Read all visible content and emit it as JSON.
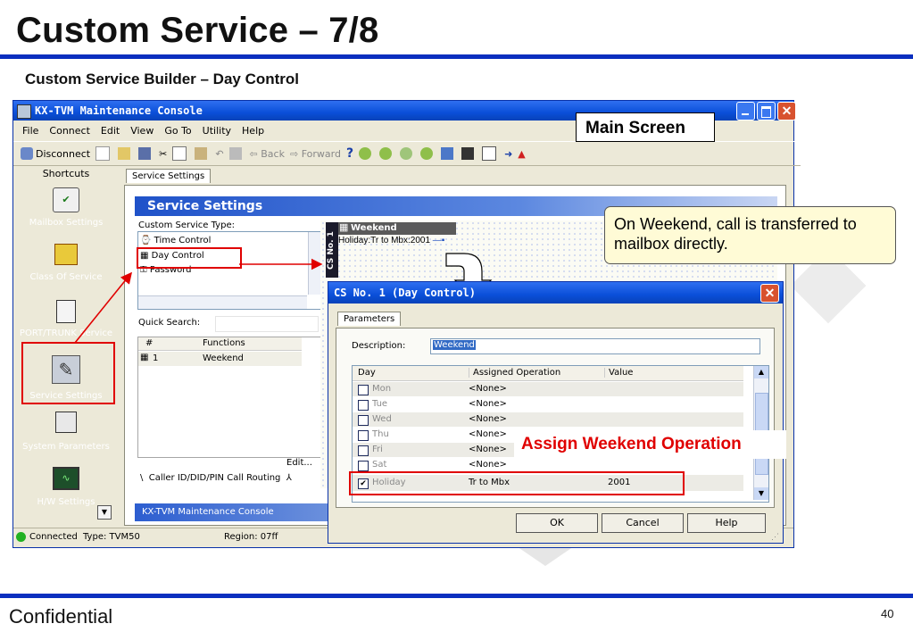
{
  "slide": {
    "title": "Custom Service – 7/8",
    "subtitle": "Custom Service Builder – Day Control",
    "footer": "Confidential",
    "page_number": "40",
    "accent_color": "#0a2fbf"
  },
  "app": {
    "window_title": "KX-TVM Maintenance Console",
    "menu": [
      "File",
      "Connect",
      "Edit",
      "View",
      "Go To",
      "Utility",
      "Help"
    ],
    "toolbar": {
      "disconnect": "Disconnect",
      "back": "Back",
      "forward": "Forward"
    },
    "sidebar": {
      "header": "Shortcuts",
      "items": [
        "Mailbox Settings",
        "Class Of Service",
        "PORT/TRUNK Service",
        "Service Settings",
        "System Parameters",
        "H/W Settings"
      ]
    },
    "tab": "Service Settings",
    "panel_title": "Service Settings",
    "custom_service_type_label": "Custom Service Type:",
    "service_types": [
      "Time Control",
      "Day Control",
      "Password"
    ],
    "quick_search_label": "Quick Search:",
    "functions_table": {
      "headers": [
        "#",
        "Functions"
      ],
      "rows": [
        {
          "num": "1",
          "function": "Weekend"
        }
      ]
    },
    "edit_link": "Edit...",
    "bottom_tab": "Caller ID/DID/PIN Call Routing",
    "diagram": {
      "node_title": "Weekend",
      "node_detail": "Holiday:Tr to Mbx:2001",
      "side_label": "CS No. 1"
    },
    "inner_status": "KX-TVM Maintenance Console",
    "status_bar": {
      "connection": "Connected",
      "type": "Type: TVM50",
      "region": "Region: 07ff"
    }
  },
  "dialog": {
    "title": "CS No. 1 (Day Control)",
    "tab": "Parameters",
    "description_label": "Description:",
    "description_value": "Weekend",
    "columns": [
      "Day",
      "Assigned Operation",
      "Value"
    ],
    "rows": [
      {
        "day": "Mon",
        "op": "<None>",
        "value": "",
        "checked": false
      },
      {
        "day": "Tue",
        "op": "<None>",
        "value": "",
        "checked": false
      },
      {
        "day": "Wed",
        "op": "<None>",
        "value": "",
        "checked": false
      },
      {
        "day": "Thu",
        "op": "<None>",
        "value": "",
        "checked": false
      },
      {
        "day": "Fri",
        "op": "<None>",
        "value": "",
        "checked": false
      },
      {
        "day": "Sat",
        "op": "<None>",
        "value": "",
        "checked": false
      },
      {
        "day": "Holiday",
        "op": "Tr to Mbx",
        "value": "2001",
        "checked": true
      }
    ],
    "buttons": {
      "ok": "OK",
      "cancel": "Cancel",
      "help": "Help"
    }
  },
  "callouts": {
    "main_screen": "Main Screen",
    "weekend_note": "On Weekend, call is transferred to mailbox directly.",
    "assign_label": "Assign Weekend Operation"
  }
}
